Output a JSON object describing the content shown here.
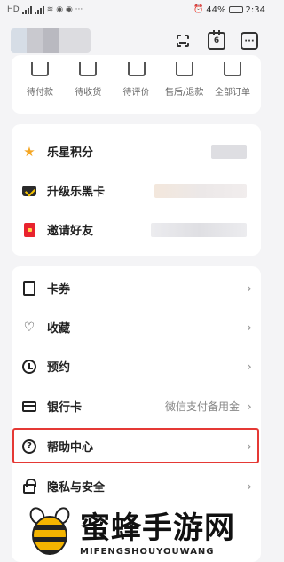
{
  "status_bar": {
    "carrier": "HD",
    "battery": "44%",
    "time": "2:34"
  },
  "header": {
    "calendar_day": "6"
  },
  "orders": [
    {
      "label": "待付款",
      "icon": "wallet-icon"
    },
    {
      "label": "待收货",
      "icon": "truck-icon"
    },
    {
      "label": "待评价",
      "icon": "comment-icon"
    },
    {
      "label": "售后/退款",
      "icon": "refund-icon"
    },
    {
      "label": "全部订单",
      "icon": "orders-icon"
    }
  ],
  "points": [
    {
      "label": "乐星积分",
      "icon": "star-icon"
    },
    {
      "label": "升级乐黑卡",
      "icon": "vip-card-icon"
    },
    {
      "label": "邀请好友",
      "icon": "gift-icon"
    }
  ],
  "menu": [
    {
      "label": "卡券",
      "icon": "ticket-icon",
      "value": ""
    },
    {
      "label": "收藏",
      "icon": "heart-icon",
      "value": ""
    },
    {
      "label": "预约",
      "icon": "clock-icon",
      "value": ""
    },
    {
      "label": "银行卡",
      "icon": "bank-card-icon",
      "value": "微信支付备用金"
    },
    {
      "label": "帮助中心",
      "icon": "help-icon",
      "value": ""
    },
    {
      "label": "隐私与安全",
      "icon": "lock-icon",
      "value": ""
    }
  ],
  "watermark": {
    "cn": "蜜蜂手游网",
    "en": "MIFENGSHOUYOUWANG"
  },
  "colors": {
    "highlight": "#e53935",
    "star": "#f5a623",
    "invite": "#e8232e",
    "background": "#f4f4f6"
  }
}
